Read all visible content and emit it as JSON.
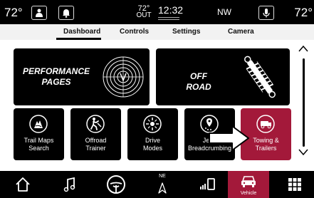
{
  "status": {
    "temp_left": "72°",
    "temp_right": "72°",
    "outside_temp": "72°",
    "outside_label": "OUT",
    "time": "12:32",
    "compass": "NW",
    "left_buttons": [
      "seat-icon",
      "notification-icon"
    ],
    "right_buttons": [
      "voice-icon"
    ]
  },
  "tabs": [
    {
      "label": "Dashboard",
      "active": true
    },
    {
      "label": "Controls",
      "active": false
    },
    {
      "label": "Settings",
      "active": false
    },
    {
      "label": "Camera",
      "active": false
    }
  ],
  "big_tiles": [
    {
      "line1": "PERFORMANCE",
      "line2": "PAGES",
      "icon": "performance-gauge-icon"
    },
    {
      "line1": "OFF ROAD",
      "line2": "",
      "icon": "suspension-shock-icon"
    }
  ],
  "apps": [
    {
      "line1": "Trail Maps",
      "line2": "Search",
      "icon": "trail-map-icon",
      "active": false
    },
    {
      "line1": "Offroad",
      "line2": "Trainer",
      "icon": "offroad-trainer-icon",
      "active": false
    },
    {
      "line1": "Drive",
      "line2": "Modes",
      "icon": "drive-modes-icon",
      "active": false
    },
    {
      "line1": "Jeep",
      "line2": "Breadcrumbing",
      "icon": "breadcrumbing-icon",
      "active": false
    },
    {
      "line1": "Towing &",
      "line2": "Trailers",
      "icon": "towing-icon",
      "active": true
    }
  ],
  "bottom_nav": [
    {
      "icon": "home-icon",
      "label": ""
    },
    {
      "icon": "music-icon",
      "label": ""
    },
    {
      "icon": "steering-icon",
      "label": ""
    },
    {
      "icon": "navigation-icon",
      "label": "NE"
    },
    {
      "icon": "phone-icon",
      "label": ""
    },
    {
      "icon": "vehicle-icon",
      "label": "Vehicle",
      "active": true
    },
    {
      "icon": "apps-grid-icon",
      "label": ""
    }
  ],
  "colors": {
    "accent": "#a3193a",
    "tile_bg": "#000000",
    "content_bg": "#ffffff",
    "tabs_bg": "#f2f2f2"
  }
}
